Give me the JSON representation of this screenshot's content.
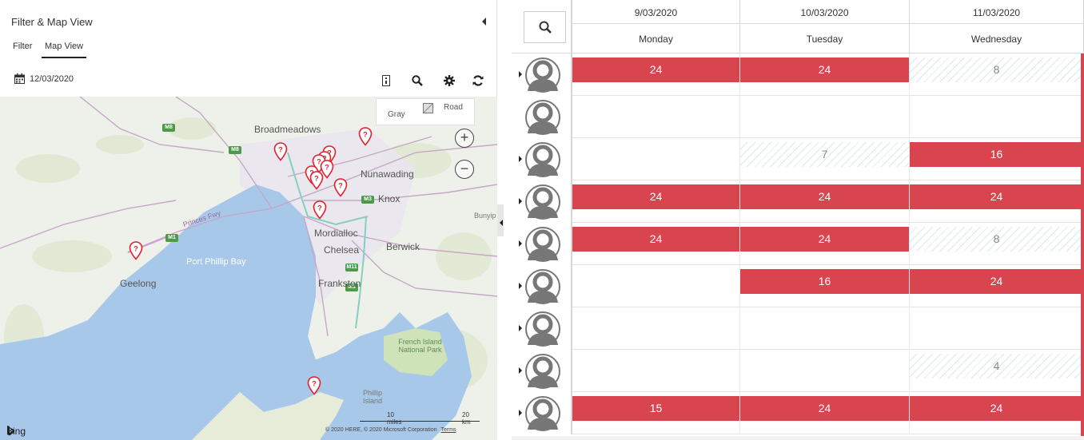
{
  "panel": {
    "title": "Filter & Map View",
    "tabs": [
      {
        "label": "Filter",
        "active": false
      },
      {
        "label": "Map View",
        "active": true
      }
    ],
    "date": "12/03/2020"
  },
  "map": {
    "maptype_gray": "Gray",
    "maptype_road": "Road",
    "zoom_in": "+",
    "zoom_out": "−",
    "labels": {
      "broadmeadows": "Broadmeadows",
      "nunawading": "Nunawading",
      "knox": "Knox",
      "bunyip": "Bunyip",
      "mordialloc": "Mordialloc",
      "chelsea": "Chelsea",
      "berwick": "Berwick",
      "port_phillip_bay": "Port Phillip Bay",
      "geelong": "Geelong",
      "frankston": "Frankston",
      "french_island": "French Island National Park",
      "phillip_island": "Phillip Island",
      "princes_fwy": "Princes Fwy"
    },
    "shields": [
      "M8",
      "M8",
      "M3",
      "M1",
      "M11",
      "M1"
    ],
    "bing": "Bing",
    "scale_miles": "10 miles",
    "scale_km": "20 km",
    "copyright": "© 2020 HERE, © 2020 Microsoft Corporation",
    "terms": "Terms",
    "pin_count": 12
  },
  "schedule": {
    "columns": [
      {
        "date": "9/03/2020",
        "day": "Monday"
      },
      {
        "date": "10/03/2020",
        "day": "Tuesday"
      },
      {
        "date": "11/03/2020",
        "day": "Wednesday"
      }
    ],
    "rows": [
      {
        "cells": [
          {
            "v": "24",
            "t": "full"
          },
          {
            "v": "24",
            "t": "full"
          },
          {
            "v": "8",
            "t": "part"
          }
        ]
      },
      {
        "cells": [
          {
            "v": "",
            "t": "empty"
          },
          {
            "v": "",
            "t": "empty"
          },
          {
            "v": "",
            "t": "empty"
          }
        ]
      },
      {
        "cells": [
          {
            "v": "",
            "t": "empty"
          },
          {
            "v": "7",
            "t": "part"
          },
          {
            "v": "16",
            "t": "full"
          }
        ]
      },
      {
        "cells": [
          {
            "v": "24",
            "t": "full"
          },
          {
            "v": "24",
            "t": "full"
          },
          {
            "v": "24",
            "t": "full"
          }
        ]
      },
      {
        "cells": [
          {
            "v": "24",
            "t": "full"
          },
          {
            "v": "24",
            "t": "full"
          },
          {
            "v": "8",
            "t": "part"
          }
        ]
      },
      {
        "cells": [
          {
            "v": "",
            "t": "empty"
          },
          {
            "v": "16",
            "t": "full"
          },
          {
            "v": "24",
            "t": "full"
          }
        ]
      },
      {
        "cells": [
          {
            "v": "",
            "t": "empty"
          },
          {
            "v": "",
            "t": "empty"
          },
          {
            "v": "",
            "t": "empty"
          }
        ]
      },
      {
        "cells": [
          {
            "v": "",
            "t": "empty"
          },
          {
            "v": "",
            "t": "empty"
          },
          {
            "v": "4",
            "t": "part"
          }
        ]
      },
      {
        "cells": [
          {
            "v": "15",
            "t": "full"
          },
          {
            "v": "24",
            "t": "full"
          },
          {
            "v": "24",
            "t": "full"
          }
        ]
      }
    ],
    "colors": {
      "full": "#d9454f",
      "part_stripe": "#dbe7ef"
    }
  }
}
